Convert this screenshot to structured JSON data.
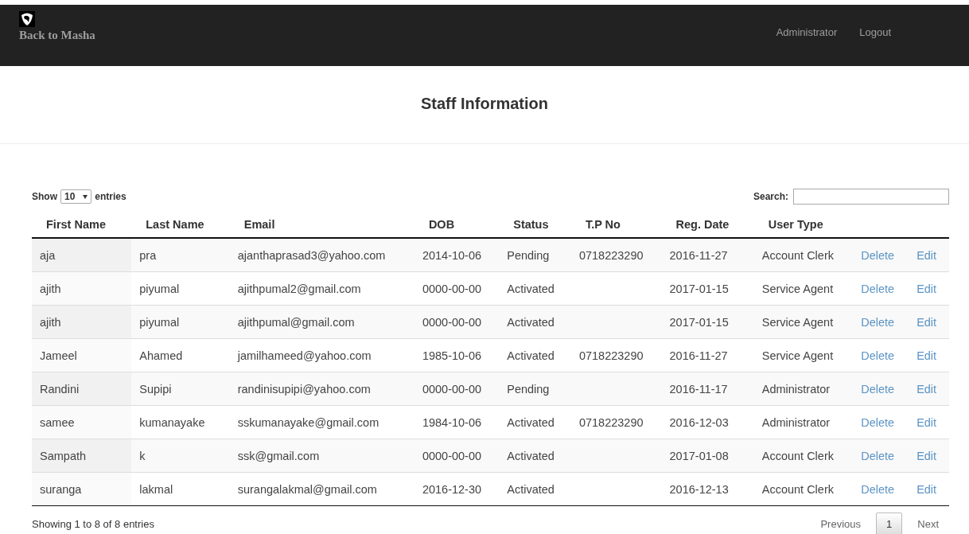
{
  "navbar": {
    "brand": "Back to Masha",
    "links": [
      "Administrator",
      "Logout"
    ]
  },
  "title": "Staff Information",
  "table_controls": {
    "show_label": "Show",
    "page_size": "10",
    "entries_label": "entries",
    "search_label": "Search:"
  },
  "table": {
    "columns": [
      "First Name",
      "Last Name",
      "Email",
      "DOB",
      "Status",
      "T.P No",
      "Reg. Date",
      "User Type"
    ],
    "rows": [
      {
        "cells": [
          "aja",
          "pra",
          "ajanthaprasad3@yahoo.com",
          "2014-10-06",
          "Pending",
          "0718223290",
          "2016-11-27",
          "Account Clerk"
        ],
        "actions": [
          "Delete",
          "Edit"
        ]
      },
      {
        "cells": [
          "ajith",
          "piyumal",
          "ajithpumal2@gmail.com",
          "0000-00-00",
          "Activated",
          "",
          "2017-01-15",
          "Service Agent"
        ],
        "actions": [
          "Delete",
          "Edit"
        ]
      },
      {
        "cells": [
          "ajith",
          "piyumal",
          "ajithpumal@gmail.com",
          "0000-00-00",
          "Activated",
          "",
          "2017-01-15",
          "Service Agent"
        ],
        "actions": [
          "Delete",
          "Edit"
        ]
      },
      {
        "cells": [
          "Jameel",
          "Ahamed",
          "jamilhameed@yahoo.com",
          "1985-10-06",
          "Activated",
          "0718223290",
          "2016-11-27",
          "Service Agent"
        ],
        "actions": [
          "Delete",
          "Edit"
        ]
      },
      {
        "cells": [
          "Randini",
          "Supipi",
          "randinisupipi@yahoo.com",
          "0000-00-00",
          "Pending",
          "",
          "2016-11-17",
          "Administrator"
        ],
        "actions": [
          "Delete",
          "Edit"
        ]
      },
      {
        "cells": [
          "samee",
          "kumanayake",
          "sskumanayake@gmail.com",
          "1984-10-06",
          "Activated",
          "0718223290",
          "2016-12-03",
          "Administrator"
        ],
        "actions": [
          "Delete",
          "Edit"
        ]
      },
      {
        "cells": [
          "Sampath",
          "k",
          "ssk@gmail.com",
          "0000-00-00",
          "Activated",
          "",
          "2017-01-08",
          "Account Clerk"
        ],
        "actions": [
          "Delete",
          "Edit"
        ]
      },
      {
        "cells": [
          "suranga",
          "lakmal",
          "surangalakmal@gmail.com",
          "2016-12-30",
          "Activated",
          "",
          "2016-12-13",
          "Account Clerk"
        ],
        "actions": [
          "Delete",
          "Edit"
        ]
      }
    ]
  },
  "footer": {
    "info": "Showing 1 to 8 of 8 entries",
    "previous": "Previous",
    "pages": [
      {
        "label": "1",
        "selected": true
      }
    ],
    "next": "Next"
  }
}
